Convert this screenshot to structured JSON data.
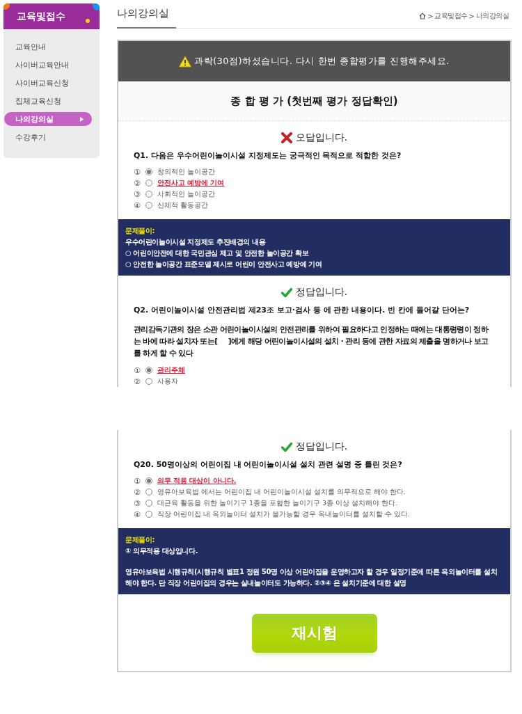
{
  "sidebar": {
    "title": "교육및접수",
    "items": [
      {
        "label": "교육안내",
        "selected": false
      },
      {
        "label": "사이버교육안내",
        "selected": false
      },
      {
        "label": "사이버교육신청",
        "selected": false
      },
      {
        "label": "집체교육신청",
        "selected": false
      },
      {
        "label": "나의강의실",
        "selected": true
      },
      {
        "label": "수강후기",
        "selected": false
      }
    ]
  },
  "header": {
    "title": "나의강의실",
    "breadcrumb": [
      "교육및접수",
      "나의강의실"
    ],
    "separator": ">"
  },
  "alert": "과락(30점)하셨습니다. 다시 한번 종합평가를 진행해주세요.",
  "exam_title": "종 합 평 가 (첫번째 평가 정답확인)",
  "fragments": [
    {
      "questions": [
        {
          "result": {
            "kind": "wrong",
            "text": "오답입니다."
          },
          "question": "Q1. 다음은 우수어린이놀이시설 지정제도는 궁극적인 목적으로 적합한 것은?",
          "options": [
            {
              "number": "①",
              "text": "창의적인 놀이공간",
              "selected": true,
              "correct": false
            },
            {
              "number": "②",
              "text": "안전사고 예방에 기여",
              "selected": false,
              "correct": true
            },
            {
              "number": "③",
              "text": "사회적인 놀이공간",
              "selected": false,
              "correct": false
            },
            {
              "number": "④",
              "text": "신체적 활동공간",
              "selected": false,
              "correct": false
            }
          ],
          "explanation": {
            "label": "문제풀이:",
            "blocks": [
              [
                "우수어린이놀이시설 지정제도 추진배경의 내용",
                "○ 어린이안전에 대한 국민관심 제고 및 안전한 놀이공간 확보",
                "○ 안전한 놀이공간 표준모델 제시로 어린이 안전사고 예방에 기여"
              ]
            ]
          }
        },
        {
          "result": {
            "kind": "correct",
            "text": "정답입니다."
          },
          "question": "Q2. 어린이놀이시설 안전관리법 제23조 보고·검사 등 에 관한 내용이다. 빈 칸에 들어갈 단어는?",
          "passage": "관리감독기관의 장은 소관 어린이놀이시설의 안전관리를 위하여 필요하다고 인정하는 때에는 대통령령이 정하는 바에 따라 설치자 또는[     ]에게 해당 어린이놀이시설의 설치 · 관리 등에 관한 자료의 제출을 명하거나 보고를 하게 할 수 있다",
          "options": [
            {
              "number": "①",
              "text": "관리주체",
              "selected": true,
              "correct": true
            },
            {
              "number": "②",
              "text": "사용자",
              "selected": false,
              "correct": false
            }
          ]
        }
      ]
    },
    {
      "questions": [
        {
          "result": {
            "kind": "correct",
            "text": "정답입니다."
          },
          "question": "Q20. 50명이상의 어린이집 내 어린이놀이시설 설치 관련 설명 중 틀린 것은?",
          "options": [
            {
              "number": "①",
              "text": "의무 적용 대상이 아니다.",
              "selected": true,
              "correct": true
            },
            {
              "number": "②",
              "text": "영유아보육법 에서는 어린이집 내 어린이놀이시설 설치를 의무적으로 해야 한다.",
              "selected": false,
              "correct": false
            },
            {
              "number": "③",
              "text": "대근육 활동을 위한 놀이기구 1종을 포함한 놀이기구 3종 이상 설치해야 한다.",
              "selected": false,
              "correct": false
            },
            {
              "number": "④",
              "text": "직장 어린이집 내 옥외놀이터 설치가 불가능할 경우 옥내놀이터를 설치할 수 있다.",
              "selected": false,
              "correct": false
            }
          ],
          "explanation": {
            "label": "문제풀이:",
            "blocks": [
              [
                "① 의무적용 대상입니다."
              ],
              [
                "영유아보육법 시행규칙(시행규칙 별표1 정원 50명 이상 어린이집을 운영하고자 할 경우 일정기준에 따른 옥외놀이터를 설치해야 한다. 단 직장 어린이집의 경우는 실내놀이터도 가능하다. ②③④ 은 설치기준에 대한 설명"
              ]
            ]
          }
        }
      ]
    }
  ],
  "retry_button": "재시험"
}
